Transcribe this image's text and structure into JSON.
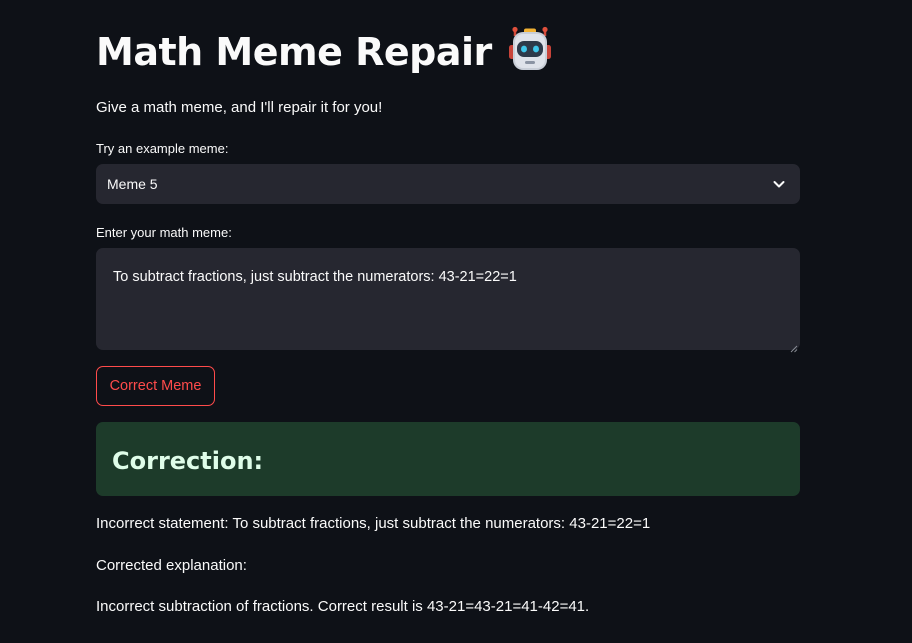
{
  "header": {
    "title": "Math Meme Repair",
    "title_icon": "robot-emoji-icon",
    "subtitle": "Give a math meme, and I'll repair it for you!"
  },
  "example_select": {
    "label": "Try an example meme:",
    "selected": "Meme 5",
    "icon": "chevron-down-icon"
  },
  "meme_input": {
    "label": "Enter your math meme:",
    "value": "To subtract fractions, just subtract the numerators: 43-21=22=1"
  },
  "correct_button": {
    "label": "Correct Meme"
  },
  "result": {
    "heading": "Correction:",
    "incorrect_statement": "Incorrect statement: To subtract fractions, just subtract the numerators: 43-21=22=1",
    "corrected_label": "Corrected explanation:",
    "corrected_text": "Incorrect subtraction of fractions. Correct result is 43-21=43-21=41-42=41."
  },
  "colors": {
    "background": "#0e1117",
    "input_bg": "#262730",
    "accent": "#ff4b4b",
    "success_bg": "#1d3b2a",
    "success_text": "#dffde9"
  }
}
